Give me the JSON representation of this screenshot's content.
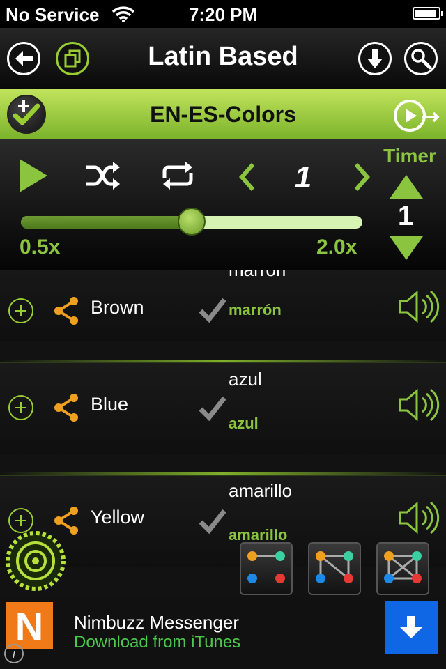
{
  "status_bar": {
    "carrier": "No Service",
    "time": "7:20 PM"
  },
  "nav": {
    "title": "Latin Based"
  },
  "deck": {
    "title": "EN-ES-Colors"
  },
  "controls": {
    "page_number": "1",
    "timer_label": "Timer",
    "timer_value": "1",
    "speed_min": "0.5x",
    "speed_max": "2.0x",
    "speed_fraction": 0.5
  },
  "cards": [
    {
      "english": "Brown",
      "top_word": "marrón",
      "bottom_word": "marrón"
    },
    {
      "english": "Blue",
      "top_word": "azul",
      "bottom_word": "azul"
    },
    {
      "english": "Yellow",
      "top_word": "amarillo",
      "bottom_word": "amarillo"
    }
  ],
  "ad": {
    "app_name": "Nimbuzz Messenger",
    "cta": "Download from iTunes",
    "logo_letter": "N"
  },
  "colors": {
    "accent_green": "#8bc53f",
    "ad_blue": "#0f67e5",
    "ad_orange": "#f07a18"
  }
}
